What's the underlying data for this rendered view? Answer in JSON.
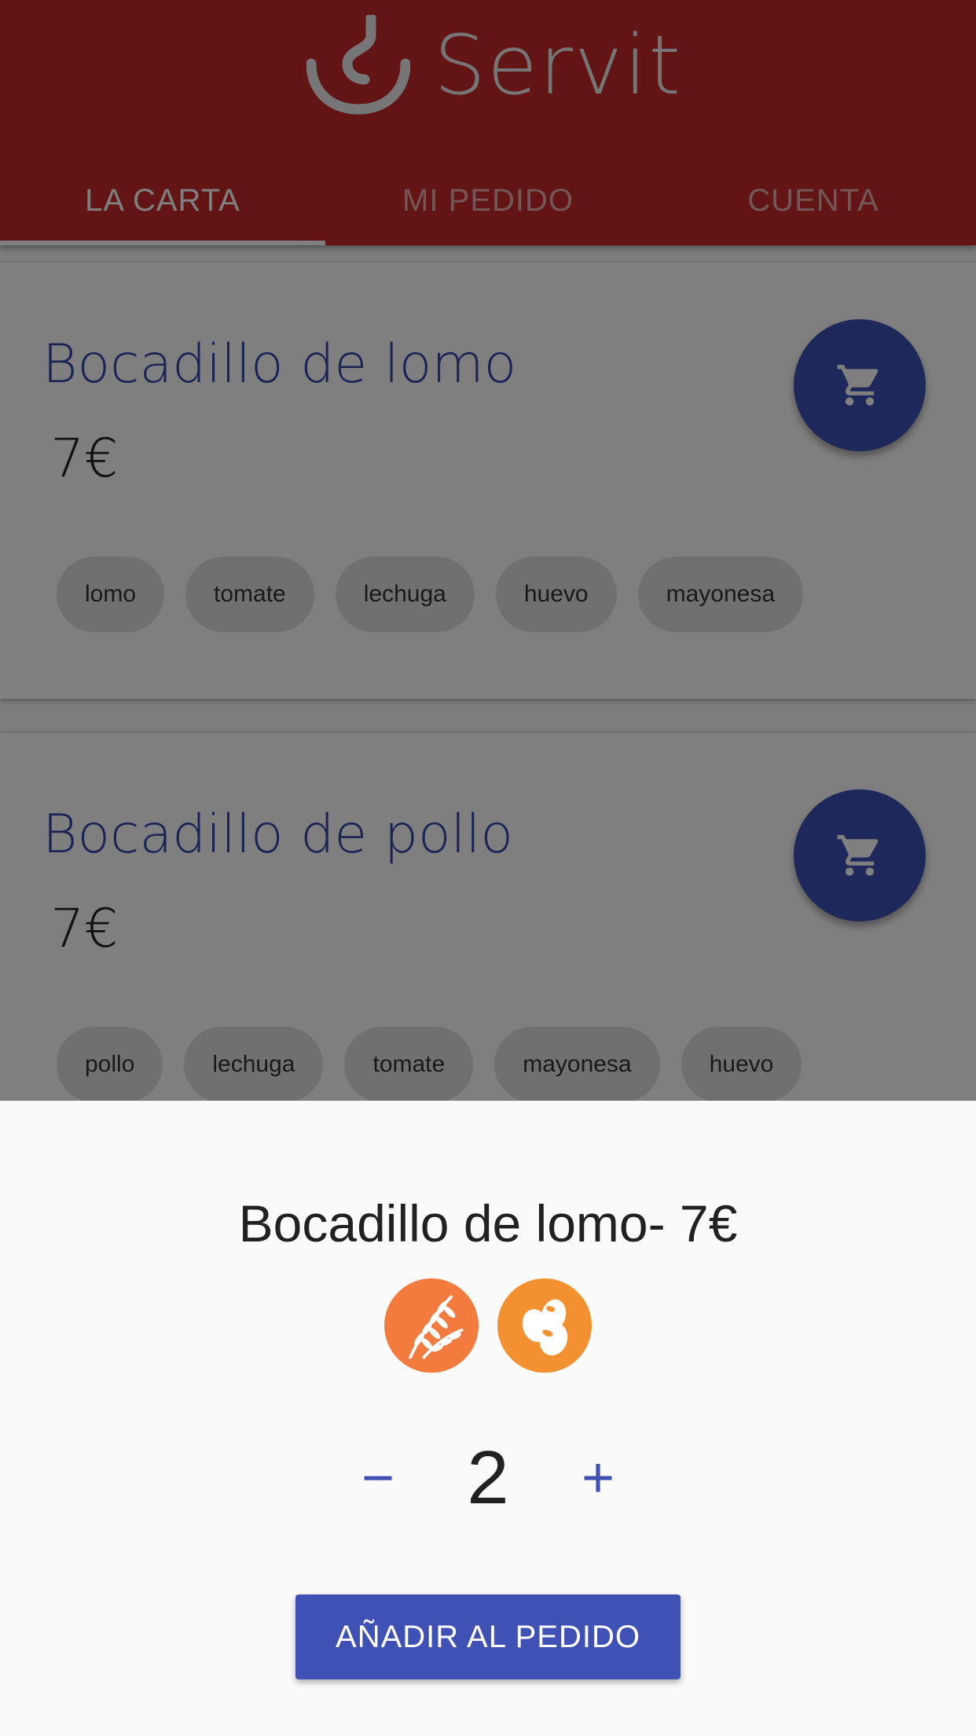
{
  "app": {
    "name": "Servit"
  },
  "tabs": [
    {
      "label": "LA CARTA",
      "active": true
    },
    {
      "label": "MI PEDIDO",
      "active": false
    },
    {
      "label": "CUENTA",
      "active": false
    }
  ],
  "menu": [
    {
      "name": "Bocadillo de lomo",
      "price": "7€",
      "ingredients": [
        "lomo",
        "tomate",
        "lechuga",
        "huevo",
        "mayonesa"
      ]
    },
    {
      "name": "Bocadillo de pollo",
      "price": "7€",
      "ingredients": [
        "pollo",
        "lechuga",
        "tomate",
        "mayonesa",
        "huevo"
      ]
    }
  ],
  "sheet": {
    "title": "Bocadillo de lomo- 7€",
    "allergens": [
      {
        "icon": "gluten-icon",
        "color": "#f47b3e"
      },
      {
        "icon": "egg-icon",
        "color": "#f39131"
      }
    ],
    "decrement": "−",
    "quantity": "2",
    "increment": "+",
    "add_button": "AÑADIR AL PEDIDO"
  },
  "colors": {
    "primary": "#c62828",
    "accent": "#3f51b5"
  }
}
